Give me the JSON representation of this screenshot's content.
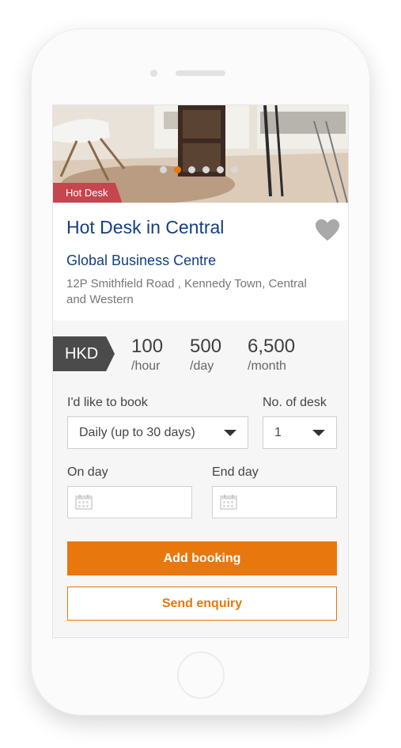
{
  "listing": {
    "tag": "Hot Desk",
    "title": "Hot Desk in Central",
    "company": "Global Business Centre",
    "address": "12P Smithfield Road , Kennedy Town, Central and Western"
  },
  "carousel": {
    "slide_count": 6,
    "active_index": 1
  },
  "pricing": {
    "currency": "HKD",
    "rates": [
      {
        "value": "100",
        "unit": "/hour"
      },
      {
        "value": "500",
        "unit": "/day"
      },
      {
        "value": "6,500",
        "unit": "/month"
      }
    ]
  },
  "booking": {
    "book_label": "I'd like to book",
    "book_value": "Daily  (up to 30 days)",
    "desk_label": "No. of desk",
    "desk_value": "1",
    "on_day_label": "On day",
    "end_day_label": "End day",
    "add_button": "Add booking",
    "enquiry_button": "Send enquiry"
  },
  "colors": {
    "accent": "#e8770e",
    "title_blue": "#123e83",
    "tag_red": "#c6454f",
    "currency_bg": "#4b4b4b"
  },
  "icons": [
    "heart-icon",
    "calendar-icon",
    "chevron-down-icon"
  ]
}
